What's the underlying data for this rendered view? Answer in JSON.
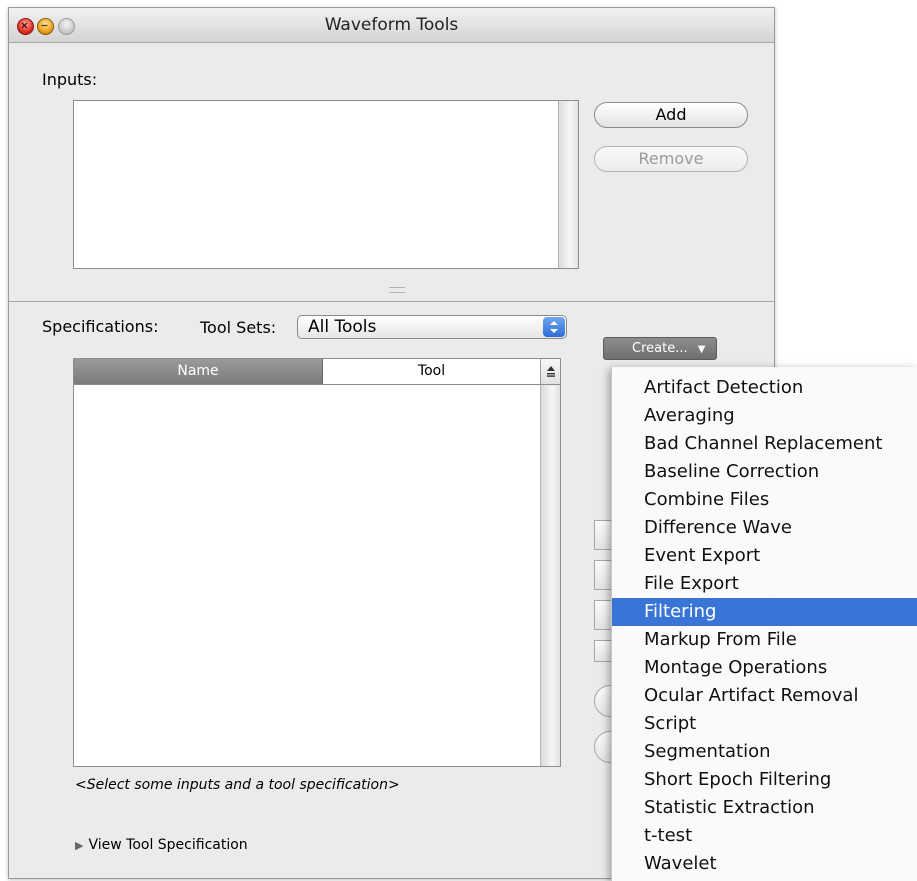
{
  "window": {
    "title": "Waveform Tools"
  },
  "inputs": {
    "label": "Inputs:",
    "add_label": "Add",
    "remove_label": "Remove"
  },
  "specifications": {
    "label": "Specifications:",
    "toolsets_label": "Tool Sets:",
    "toolsets_value": "All Tools",
    "columns": [
      "Name",
      "Tool"
    ],
    "hint": "<Select some inputs and a tool specification>",
    "view_toggle_label": "View Tool Specification"
  },
  "create_button": {
    "label": "Create..."
  },
  "menu": {
    "items": [
      "Artifact Detection",
      "Averaging",
      "Bad Channel Replacement",
      "Baseline Correction",
      "Combine Files",
      "Difference Wave",
      "Event Export",
      "File Export",
      "Filtering",
      "Markup From File",
      "Montage Operations",
      "Ocular Artifact Removal",
      "Script",
      "Segmentation",
      "Short Epoch Filtering",
      "Statistic Extraction",
      "t-test",
      "Wavelet"
    ],
    "selected": "Filtering"
  },
  "colors": {
    "selection": "#3875d7",
    "window_bg": "#ebebeb"
  }
}
